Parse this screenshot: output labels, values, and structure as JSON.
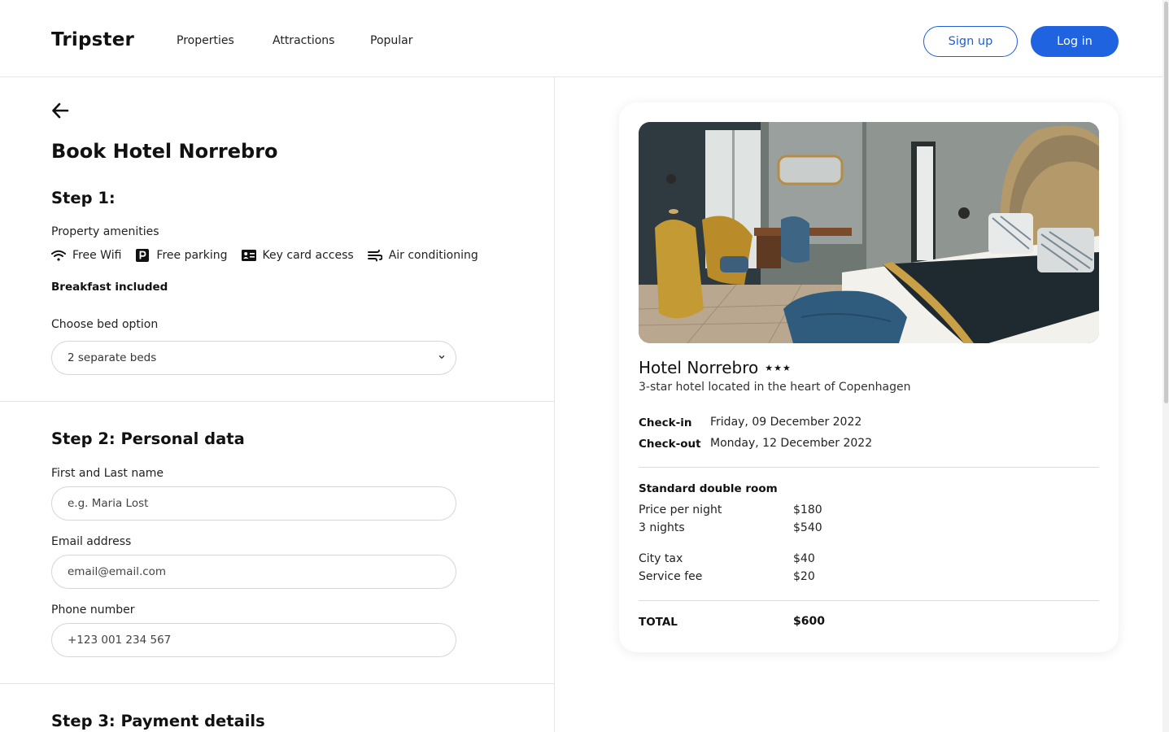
{
  "header": {
    "logo": "Tripster",
    "nav": [
      "Properties",
      "Attractions",
      "Popular"
    ],
    "signup_label": "Sign up",
    "login_label": "Log in"
  },
  "booking": {
    "title": "Book Hotel Norrebro",
    "step1": {
      "heading": "Step 1:",
      "amenities_label": "Property amenities",
      "amenities": [
        {
          "icon": "wifi-icon",
          "label": "Free Wifi"
        },
        {
          "icon": "parking-icon",
          "label": "Free parking"
        },
        {
          "icon": "key-card-icon",
          "label": "Key card access"
        },
        {
          "icon": "air-conditioning-icon",
          "label": "Air conditioning"
        }
      ],
      "breakfast": "Breakfast included",
      "bed_label": "Choose bed option",
      "bed_value": "2 separate beds"
    },
    "step2": {
      "heading": "Step 2: Personal data",
      "name_label": "First and Last name",
      "name_placeholder": "e.g. Maria Lost",
      "email_label": "Email address",
      "email_placeholder": "email@email.com",
      "phone_label": "Phone number",
      "phone_placeholder": "+123 001 234 567"
    },
    "step3": {
      "heading": "Step 3: Payment details"
    }
  },
  "summary": {
    "hotel_name": "Hotel Norrebro",
    "stars": "★★★",
    "description": "3-star hotel located in the heart of Copenhagen",
    "checkin_label": "Check-in",
    "checkin_value": "Friday, 09 December 2022",
    "checkout_label": "Check-out",
    "checkout_value": "Monday, 12 December 2022",
    "room_type": "Standard double room",
    "lines": [
      {
        "label": "Price per night",
        "value": "$180"
      },
      {
        "label": "3 nights",
        "value": "$540"
      },
      {
        "label": "City tax",
        "value": "$40"
      },
      {
        "label": "Service fee",
        "value": "$20"
      }
    ],
    "total_label": "TOTAL",
    "total_value": "$600"
  },
  "colors": {
    "accent": "#1f63e0",
    "border": "#e4e4e4",
    "text": "#111111"
  }
}
